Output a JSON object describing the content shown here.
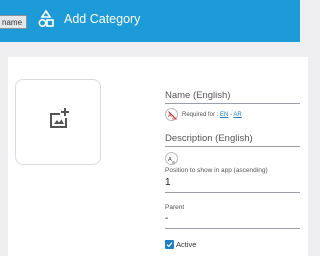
{
  "header": {
    "title": "Add Category",
    "tooltip": "name",
    "icon": "shapes-icon",
    "background_color": "#1d9bd8"
  },
  "image_upload": {
    "icon": "add-photo-icon"
  },
  "name_field": {
    "label": "Name (English)",
    "required_prefix": "Required for :",
    "required_lang_en": "EN",
    "required_separator": "-",
    "required_lang_ar": "AR",
    "translate_icon": "translate-off-icon"
  },
  "description_field": {
    "label": "Description (English)",
    "translate_icon": "translate-icon"
  },
  "position_field": {
    "label": "Position to show in app (ascending)",
    "value": "1"
  },
  "parent_field": {
    "label": "Parent",
    "value": "-"
  },
  "active_checkbox": {
    "label": "Active",
    "checked": true,
    "color": "#1d7fc7"
  }
}
